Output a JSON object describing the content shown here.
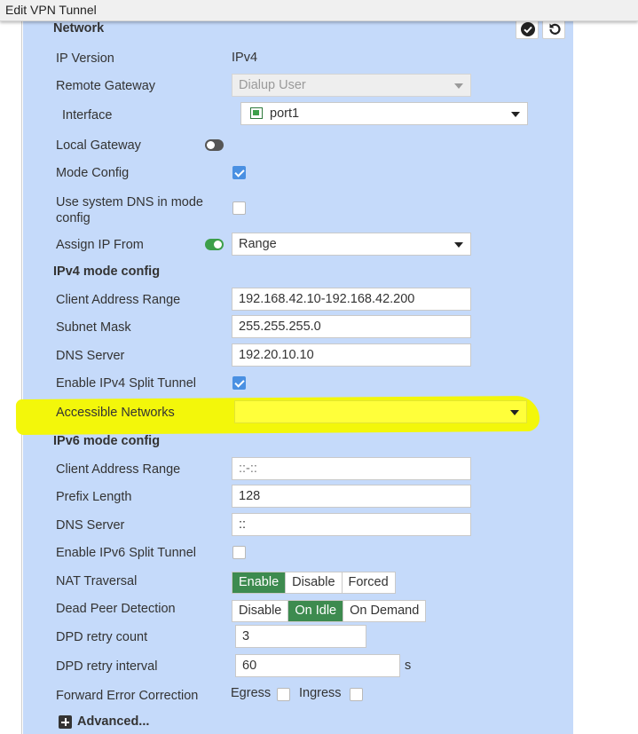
{
  "window": {
    "title": "Edit VPN Tunnel"
  },
  "network": {
    "header": "Network",
    "ip_version": {
      "label": "IP Version",
      "value": "IPv4"
    },
    "remote_gateway": {
      "label": "Remote Gateway",
      "value": "Dialup User"
    },
    "interface": {
      "label": "Interface",
      "value": "port1"
    },
    "local_gateway": {
      "label": "Local Gateway",
      "enabled": false
    },
    "mode_config": {
      "label": "Mode Config",
      "checked": true
    },
    "use_system_dns": {
      "label": "Use system DNS in mode config",
      "checked": false
    },
    "assign_ip_from": {
      "label": "Assign IP From",
      "toggle_on": true,
      "value": "Range"
    }
  },
  "ipv4": {
    "header": "IPv4 mode config",
    "client_address_range": {
      "label": "Client Address Range",
      "value": "192.168.42.10-192.168.42.200"
    },
    "subnet_mask": {
      "label": "Subnet Mask",
      "value": "255.255.255.0"
    },
    "dns_server": {
      "label": "DNS Server",
      "value": "192.20.10.10"
    },
    "split_tunnel": {
      "label": "Enable IPv4 Split Tunnel",
      "checked": true
    },
    "accessible_networks": {
      "label": "Accessible Networks",
      "value": ""
    }
  },
  "ipv6": {
    "header": "IPv6 mode config",
    "client_address_range": {
      "label": "Client Address Range",
      "value": "::-::"
    },
    "prefix_length": {
      "label": "Prefix Length",
      "value": "128"
    },
    "dns_server": {
      "label": "DNS Server",
      "value": "::"
    },
    "split_tunnel": {
      "label": "Enable IPv6 Split Tunnel",
      "checked": false
    }
  },
  "nat_traversal": {
    "label": "NAT Traversal",
    "options": [
      "Enable",
      "Disable",
      "Forced"
    ],
    "selected": "Enable"
  },
  "dead_peer_detection": {
    "label": "Dead Peer Detection",
    "options": [
      "Disable",
      "On Idle",
      "On Demand"
    ],
    "selected": "On Idle"
  },
  "dpd_retry_count": {
    "label": "DPD retry count",
    "value": "3"
  },
  "dpd_retry_interval": {
    "label": "DPD retry interval",
    "value": "60",
    "unit": "s"
  },
  "forward_error_correction": {
    "label": "Forward Error Correction",
    "egress_label": "Egress",
    "egress_checked": false,
    "ingress_label": "Ingress",
    "ingress_checked": false
  },
  "advanced": {
    "label": "Advanced..."
  },
  "colors": {
    "panel_bg": "#c5dafa",
    "accent_green": "#3d8b4f",
    "checkbox_blue": "#4a90e2",
    "highlight": "#f3f70a"
  },
  "icons": {
    "apply": "check-circle-icon",
    "revert": "undo-icon",
    "interface": "ethernet-port-icon",
    "advanced": "plus-square-icon"
  }
}
